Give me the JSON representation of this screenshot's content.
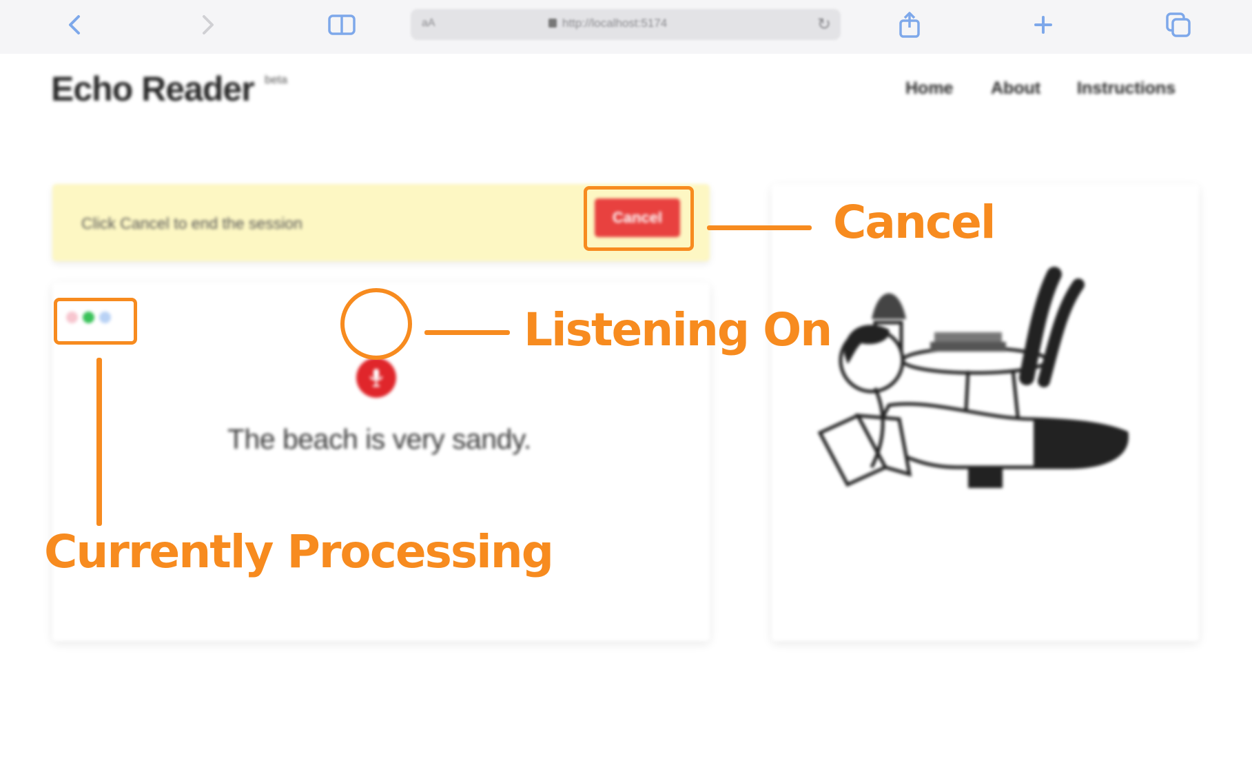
{
  "browser": {
    "address_left": "aA",
    "url": "http://localhost:5174",
    "icons": [
      "back-icon",
      "forward-icon",
      "book-icon",
      "reload-icon",
      "share-icon",
      "new-tab-icon",
      "tabs-icon"
    ]
  },
  "header": {
    "brand": "Echo Reader",
    "badge": "beta",
    "nav": [
      "Home",
      "About",
      "Instructions"
    ]
  },
  "banner": {
    "text": "Click Cancel to end the session",
    "cancel_label": "Cancel"
  },
  "reader": {
    "sentence": "The beach is very sandy.",
    "processing_dots": [
      "#f7c6cf",
      "#3ac25a",
      "#b9d2f5"
    ]
  },
  "annotations": {
    "cancel": "Cancel",
    "listening": "Listening On",
    "processing": "Currently Processing"
  },
  "colors": {
    "accent": "#f78b1f",
    "cancel_button": "#e8413f",
    "mic_button": "#e0262b",
    "banner_bg": "#fdf7c3",
    "chrome_icon": "#7ea8ea"
  }
}
